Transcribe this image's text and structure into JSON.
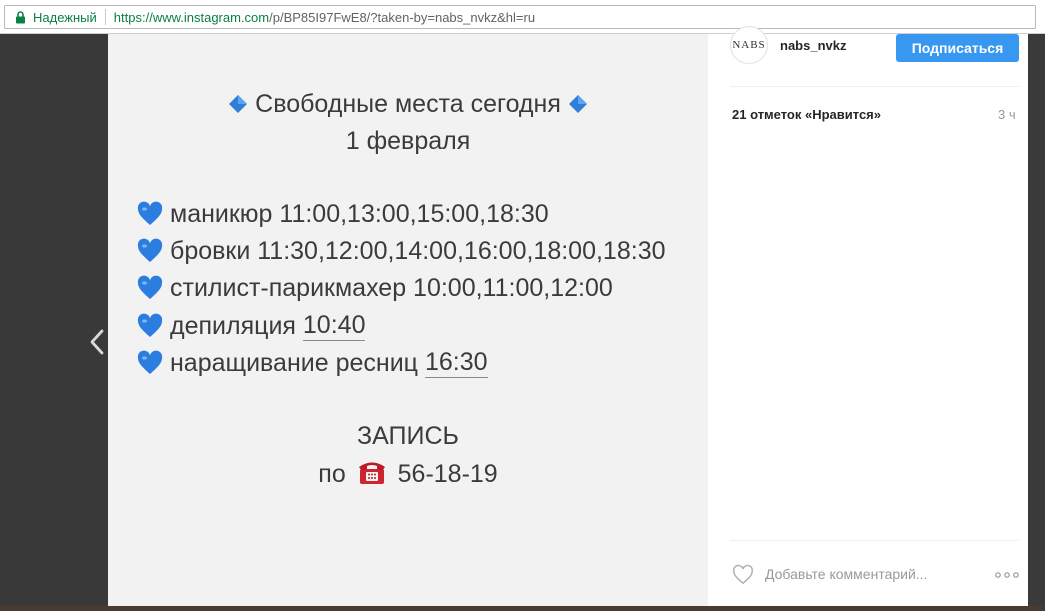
{
  "browser": {
    "secure_label": "Надежный",
    "url_scheme": "https://",
    "url_host": "www.instagram.com",
    "url_path": "/p/BP85I97FwE8/?taken-by=nabs_nvkz&hl=ru"
  },
  "post_image": {
    "title": "Свободные места сегодня",
    "date": "1 февраля",
    "items": [
      {
        "label": "маникюр 11:00,13:00,15:00,18:30",
        "extra": ""
      },
      {
        "label": "бровки 11:30,12:00,14:00,16:00,18:00,18:30",
        "extra": ""
      },
      {
        "label": "стилист-парикмахер 10:00,11:00,12:00",
        "extra": ""
      },
      {
        "label": "депиляция",
        "extra": "10:40"
      },
      {
        "label": "наращивание ресниц",
        "extra": "16:30"
      }
    ],
    "booking": "ЗАПИСЬ",
    "phone_prefix": "по",
    "phone": "56-18-19"
  },
  "profile": {
    "avatar_text": "NABS",
    "username": "nabs_nvkz",
    "follow_label": "Подписаться"
  },
  "post": {
    "likes": "21 отметок «Нравится»",
    "time": "3 ч",
    "comment_placeholder": "Добавьте комментарий..."
  },
  "icons": {
    "lock": "lock-icon",
    "prev": "chevron-left-icon",
    "heart": "blue-heart-icon",
    "diamond": "blue-diamond-icon",
    "phone": "telephone-icon",
    "like": "heart-outline-icon",
    "more": "more-dots-icon"
  },
  "colors": {
    "secure_green": "#0b8043",
    "follow_blue": "#3897f0",
    "heart_blue": "#2b7de0"
  }
}
